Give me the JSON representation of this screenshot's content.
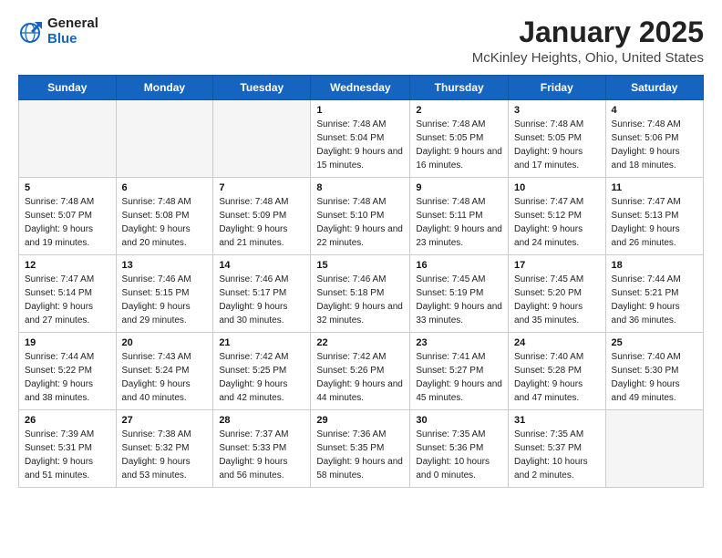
{
  "header": {
    "logo_general": "General",
    "logo_blue": "Blue",
    "month_title": "January 2025",
    "location": "McKinley Heights, Ohio, United States"
  },
  "weekdays": [
    "Sunday",
    "Monday",
    "Tuesday",
    "Wednesday",
    "Thursday",
    "Friday",
    "Saturday"
  ],
  "weeks": [
    [
      {
        "day": "",
        "sunrise": "",
        "sunset": "",
        "daylight": ""
      },
      {
        "day": "",
        "sunrise": "",
        "sunset": "",
        "daylight": ""
      },
      {
        "day": "",
        "sunrise": "",
        "sunset": "",
        "daylight": ""
      },
      {
        "day": "1",
        "sunrise": "Sunrise: 7:48 AM",
        "sunset": "Sunset: 5:04 PM",
        "daylight": "Daylight: 9 hours and 15 minutes."
      },
      {
        "day": "2",
        "sunrise": "Sunrise: 7:48 AM",
        "sunset": "Sunset: 5:05 PM",
        "daylight": "Daylight: 9 hours and 16 minutes."
      },
      {
        "day": "3",
        "sunrise": "Sunrise: 7:48 AM",
        "sunset": "Sunset: 5:05 PM",
        "daylight": "Daylight: 9 hours and 17 minutes."
      },
      {
        "day": "4",
        "sunrise": "Sunrise: 7:48 AM",
        "sunset": "Sunset: 5:06 PM",
        "daylight": "Daylight: 9 hours and 18 minutes."
      }
    ],
    [
      {
        "day": "5",
        "sunrise": "Sunrise: 7:48 AM",
        "sunset": "Sunset: 5:07 PM",
        "daylight": "Daylight: 9 hours and 19 minutes."
      },
      {
        "day": "6",
        "sunrise": "Sunrise: 7:48 AM",
        "sunset": "Sunset: 5:08 PM",
        "daylight": "Daylight: 9 hours and 20 minutes."
      },
      {
        "day": "7",
        "sunrise": "Sunrise: 7:48 AM",
        "sunset": "Sunset: 5:09 PM",
        "daylight": "Daylight: 9 hours and 21 minutes."
      },
      {
        "day": "8",
        "sunrise": "Sunrise: 7:48 AM",
        "sunset": "Sunset: 5:10 PM",
        "daylight": "Daylight: 9 hours and 22 minutes."
      },
      {
        "day": "9",
        "sunrise": "Sunrise: 7:48 AM",
        "sunset": "Sunset: 5:11 PM",
        "daylight": "Daylight: 9 hours and 23 minutes."
      },
      {
        "day": "10",
        "sunrise": "Sunrise: 7:47 AM",
        "sunset": "Sunset: 5:12 PM",
        "daylight": "Daylight: 9 hours and 24 minutes."
      },
      {
        "day": "11",
        "sunrise": "Sunrise: 7:47 AM",
        "sunset": "Sunset: 5:13 PM",
        "daylight": "Daylight: 9 hours and 26 minutes."
      }
    ],
    [
      {
        "day": "12",
        "sunrise": "Sunrise: 7:47 AM",
        "sunset": "Sunset: 5:14 PM",
        "daylight": "Daylight: 9 hours and 27 minutes."
      },
      {
        "day": "13",
        "sunrise": "Sunrise: 7:46 AM",
        "sunset": "Sunset: 5:15 PM",
        "daylight": "Daylight: 9 hours and 29 minutes."
      },
      {
        "day": "14",
        "sunrise": "Sunrise: 7:46 AM",
        "sunset": "Sunset: 5:17 PM",
        "daylight": "Daylight: 9 hours and 30 minutes."
      },
      {
        "day": "15",
        "sunrise": "Sunrise: 7:46 AM",
        "sunset": "Sunset: 5:18 PM",
        "daylight": "Daylight: 9 hours and 32 minutes."
      },
      {
        "day": "16",
        "sunrise": "Sunrise: 7:45 AM",
        "sunset": "Sunset: 5:19 PM",
        "daylight": "Daylight: 9 hours and 33 minutes."
      },
      {
        "day": "17",
        "sunrise": "Sunrise: 7:45 AM",
        "sunset": "Sunset: 5:20 PM",
        "daylight": "Daylight: 9 hours and 35 minutes."
      },
      {
        "day": "18",
        "sunrise": "Sunrise: 7:44 AM",
        "sunset": "Sunset: 5:21 PM",
        "daylight": "Daylight: 9 hours and 36 minutes."
      }
    ],
    [
      {
        "day": "19",
        "sunrise": "Sunrise: 7:44 AM",
        "sunset": "Sunset: 5:22 PM",
        "daylight": "Daylight: 9 hours and 38 minutes."
      },
      {
        "day": "20",
        "sunrise": "Sunrise: 7:43 AM",
        "sunset": "Sunset: 5:24 PM",
        "daylight": "Daylight: 9 hours and 40 minutes."
      },
      {
        "day": "21",
        "sunrise": "Sunrise: 7:42 AM",
        "sunset": "Sunset: 5:25 PM",
        "daylight": "Daylight: 9 hours and 42 minutes."
      },
      {
        "day": "22",
        "sunrise": "Sunrise: 7:42 AM",
        "sunset": "Sunset: 5:26 PM",
        "daylight": "Daylight: 9 hours and 44 minutes."
      },
      {
        "day": "23",
        "sunrise": "Sunrise: 7:41 AM",
        "sunset": "Sunset: 5:27 PM",
        "daylight": "Daylight: 9 hours and 45 minutes."
      },
      {
        "day": "24",
        "sunrise": "Sunrise: 7:40 AM",
        "sunset": "Sunset: 5:28 PM",
        "daylight": "Daylight: 9 hours and 47 minutes."
      },
      {
        "day": "25",
        "sunrise": "Sunrise: 7:40 AM",
        "sunset": "Sunset: 5:30 PM",
        "daylight": "Daylight: 9 hours and 49 minutes."
      }
    ],
    [
      {
        "day": "26",
        "sunrise": "Sunrise: 7:39 AM",
        "sunset": "Sunset: 5:31 PM",
        "daylight": "Daylight: 9 hours and 51 minutes."
      },
      {
        "day": "27",
        "sunrise": "Sunrise: 7:38 AM",
        "sunset": "Sunset: 5:32 PM",
        "daylight": "Daylight: 9 hours and 53 minutes."
      },
      {
        "day": "28",
        "sunrise": "Sunrise: 7:37 AM",
        "sunset": "Sunset: 5:33 PM",
        "daylight": "Daylight: 9 hours and 56 minutes."
      },
      {
        "day": "29",
        "sunrise": "Sunrise: 7:36 AM",
        "sunset": "Sunset: 5:35 PM",
        "daylight": "Daylight: 9 hours and 58 minutes."
      },
      {
        "day": "30",
        "sunrise": "Sunrise: 7:35 AM",
        "sunset": "Sunset: 5:36 PM",
        "daylight": "Daylight: 10 hours and 0 minutes."
      },
      {
        "day": "31",
        "sunrise": "Sunrise: 7:35 AM",
        "sunset": "Sunset: 5:37 PM",
        "daylight": "Daylight: 10 hours and 2 minutes."
      },
      {
        "day": "",
        "sunrise": "",
        "sunset": "",
        "daylight": ""
      }
    ]
  ]
}
